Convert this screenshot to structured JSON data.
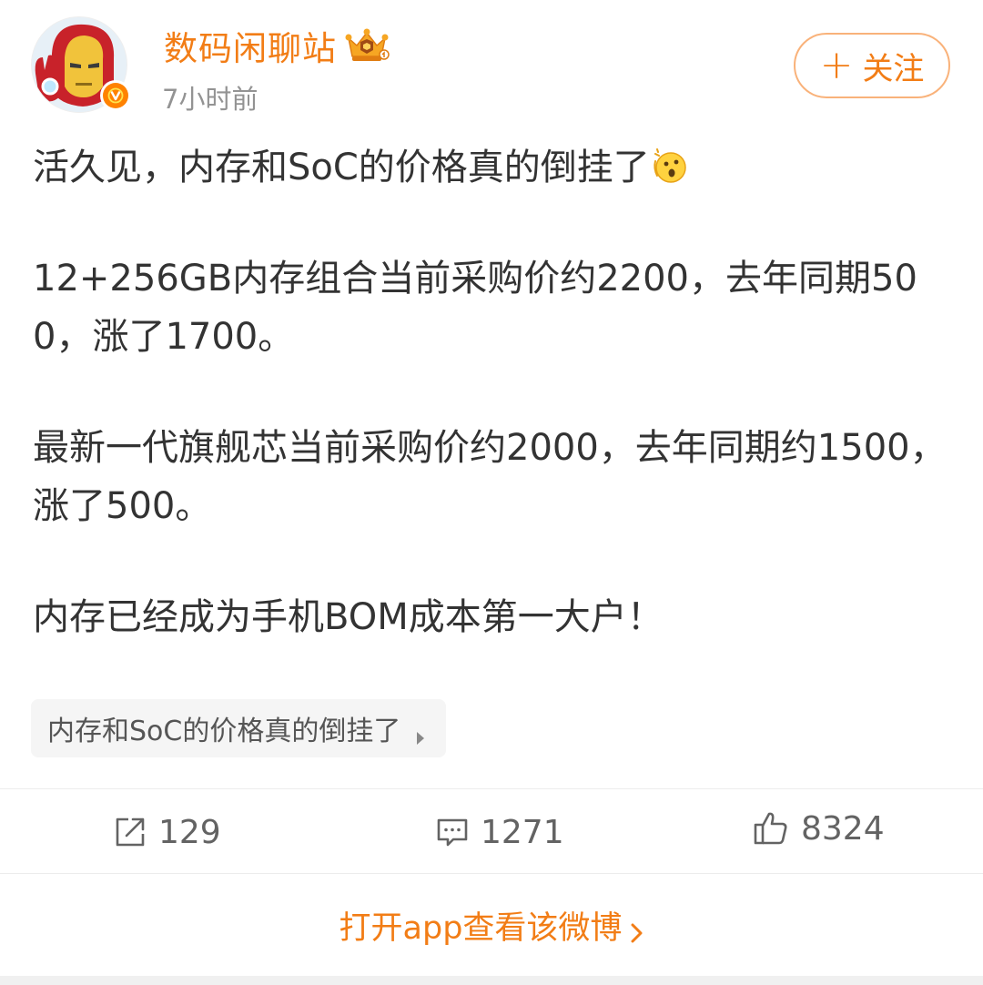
{
  "user": {
    "name": "数码闲聊站",
    "post_time": "7小时前",
    "avatar_icon": "ironman-avatar-icon",
    "level_icon": "crown-icon",
    "verified_icon": "verified-v-icon",
    "verified_text": "V"
  },
  "follow": {
    "label": "关注",
    "plus": "+"
  },
  "post": {
    "paragraphs": [
      "活久见，内存和SoC的价格真的倒挂了",
      "12+256GB内存组合当前采购价约2200，去年同期500，涨了1700。",
      "最新一代旗舰芯当前采购价约2000，去年同期约1500，涨了500。",
      "内存已经成为手机BOM成本第一大户！"
    ],
    "emoji_icon": "surprised-face-emoji-icon"
  },
  "topic": {
    "label": "内存和SoC的价格真的倒挂了"
  },
  "actions": {
    "repost_count": "129",
    "comment_count": "1271",
    "like_count": "8324"
  },
  "open_app": {
    "label": "打开app查看该微博"
  },
  "colors": {
    "accent": "#f27d16",
    "text": "#333333",
    "muted": "#939393",
    "chip_bg": "#f5f5f5",
    "verified": "#ff8200"
  }
}
